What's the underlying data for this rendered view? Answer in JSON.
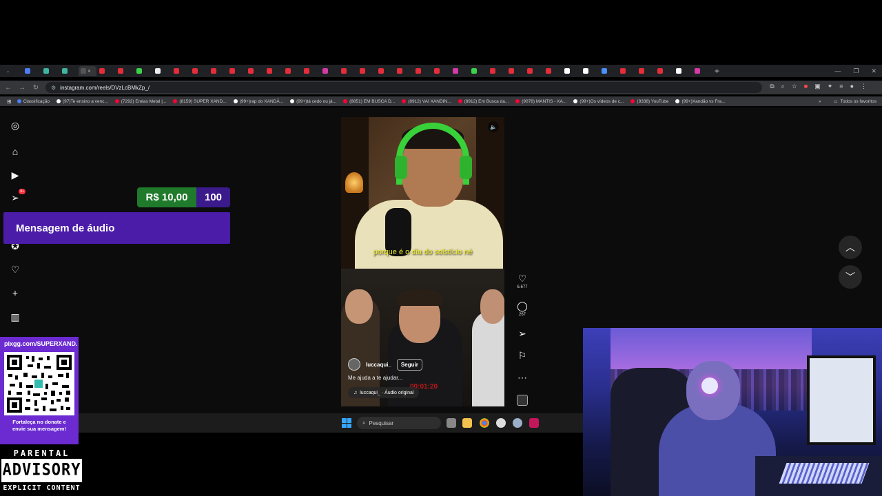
{
  "browser": {
    "url": "instagram.com/reels/DVzLcBMkZp_/",
    "bookmarks": [
      {
        "label": "Classificação",
        "color": "#4f7cf7"
      },
      {
        "label": "(97)Te ensino a venc...",
        "color": "#ffffff"
      },
      {
        "label": "(7292) Enéas Metal |...",
        "color": "#ff0033"
      },
      {
        "label": "(8159) SUPER XAND...",
        "color": "#ff0033"
      },
      {
        "label": "(99+)rap do XANDÃ...",
        "color": "#ffffff"
      },
      {
        "label": "(99+)tá cedo ou já...",
        "color": "#ffffff"
      },
      {
        "label": "(8851) EM BUSCA D...",
        "color": "#ff0033"
      },
      {
        "label": "(8912) VAI XANDIN...",
        "color": "#ff0033"
      },
      {
        "label": "(8912) Em Busca da...",
        "color": "#ff0033"
      },
      {
        "label": "(9078) MANTIS - XA...",
        "color": "#ff0033"
      },
      {
        "label": "(99+)Os vídeos de c...",
        "color": "#ffffff"
      },
      {
        "label": "(9338) YouTube",
        "color": "#ff0033"
      },
      {
        "label": "(99+)Xandão vs Fra...",
        "color": "#ffffff"
      }
    ],
    "all_bookmarks": "Todos os favoritos"
  },
  "stream": {
    "donate_amount": "R$ 10,00",
    "donate_count": "100",
    "audio_message": "Mensagem de áudio",
    "pix_url": "pixgg.com/SUPERXAND...",
    "pix_footer_1": "Fortaleça no donate e",
    "pix_footer_2": "envie sua mensagem!",
    "advisory_top": "PARENTAL",
    "advisory_mid": "ADVISORY",
    "advisory_bot": "EXPLICIT CONTENT"
  },
  "instagram": {
    "sidebar_badge": "9+",
    "reel": {
      "caption": "porque é o dia do solstício né",
      "timer": "00:01:20",
      "author": "luccaqui_",
      "follow": "Seguir",
      "description": "Me ajuda a te ajudar...",
      "audio": "luccaqui_ · Áudio original"
    },
    "likes": "6.677",
    "comments": "267"
  },
  "taskbar": {
    "search_placeholder": "Pesquisar"
  },
  "colors": {
    "donate_green": "#1f7a2b",
    "purple": "#4a1ca8",
    "pix_purple": "#6b2bd1"
  }
}
